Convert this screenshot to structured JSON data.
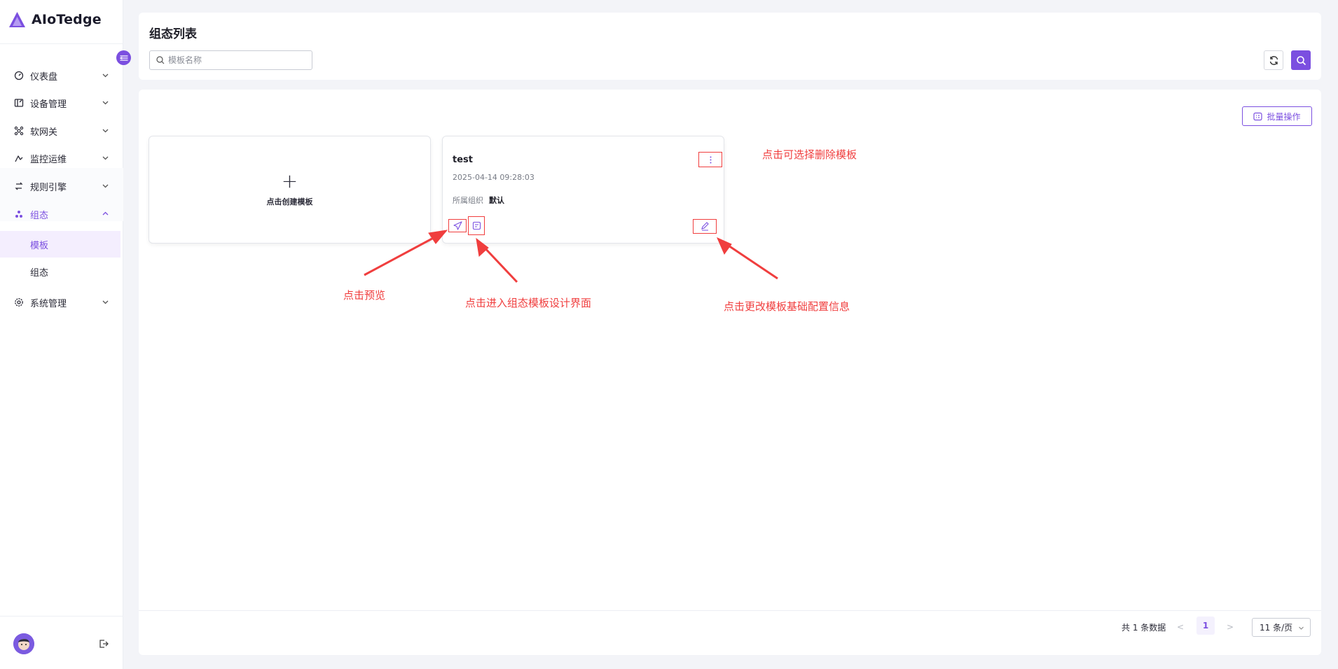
{
  "app": {
    "name": "AIoTedge"
  },
  "colors": {
    "accent": "#7b4fe0",
    "annotation": "#f03e3e"
  },
  "sidebar": {
    "items": [
      {
        "label": "仪表盘",
        "icon": "dashboard-icon"
      },
      {
        "label": "设备管理",
        "icon": "device-icon"
      },
      {
        "label": "软网关",
        "icon": "gateway-icon"
      },
      {
        "label": "监控运维",
        "icon": "monitor-icon"
      },
      {
        "label": "规则引擎",
        "icon": "rule-icon"
      },
      {
        "label": "组态",
        "icon": "scada-icon",
        "expanded": true
      },
      {
        "label": "系统管理",
        "icon": "settings-icon"
      }
    ],
    "subitems": [
      {
        "label": "模板",
        "selected": true
      },
      {
        "label": "组态",
        "selected": false
      }
    ]
  },
  "header": {
    "title": "组态列表",
    "search_placeholder": "模板名称"
  },
  "toolbar": {
    "batch_label": "批量操作"
  },
  "create_card": {
    "label": "点击创建模板",
    "plus": "+"
  },
  "template_card": {
    "name": "test",
    "time": "2025-04-14 09:28:03",
    "org_label": "所属组织",
    "org_value": "默认"
  },
  "pagination": {
    "total_text": "共 1 条数据",
    "prev": "<",
    "current": "1",
    "next": ">",
    "page_size": "11 条/页"
  },
  "annotations": {
    "delete": "点击可选择删除模板",
    "preview": "点击预览",
    "design": "点击进入组态模板设计界面",
    "edit": "点击更改模板基础配置信息"
  }
}
